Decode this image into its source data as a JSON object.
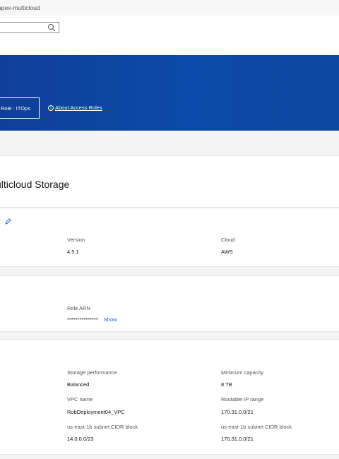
{
  "topbar": {
    "breadcrumb": "apex-multicloud"
  },
  "search": {
    "placeholder": ""
  },
  "banner": {
    "role_button": "Role :  ITOps",
    "about_link": "About Access Roles"
  },
  "page": {
    "title": "ulticloud Storage"
  },
  "summary": {
    "partial_label": "y",
    "version_label": "Version",
    "version_value": "4.5.1",
    "cloud_label": "Cloud",
    "cloud_value": "AWS"
  },
  "role_section": {
    "role_arn_label": "Role ARN",
    "role_arn_value": "***************",
    "show_label": "Show"
  },
  "storage_section": {
    "storage_perf_label": "Storage performance",
    "storage_perf_value": "Balanced",
    "min_capacity_label": "Minimum capacity",
    "min_capacity_value": "8 TB",
    "vpc_name_label": "VPC name",
    "vpc_name_value": "RobDeployment04_VPC",
    "routable_ip_label": "Routable IP range",
    "routable_ip_value": "170.31.0.0/21",
    "subnet1_label": "us-east-1b subnet CIDR block",
    "subnet1_value": "14.0.0.0/23",
    "subnet2_label": "us-east-1b subnet CIDR block",
    "subnet2_value": "170.31.0.0/21"
  },
  "colors": {
    "banner": "#0f3f9a",
    "link": "#0f62fe"
  }
}
